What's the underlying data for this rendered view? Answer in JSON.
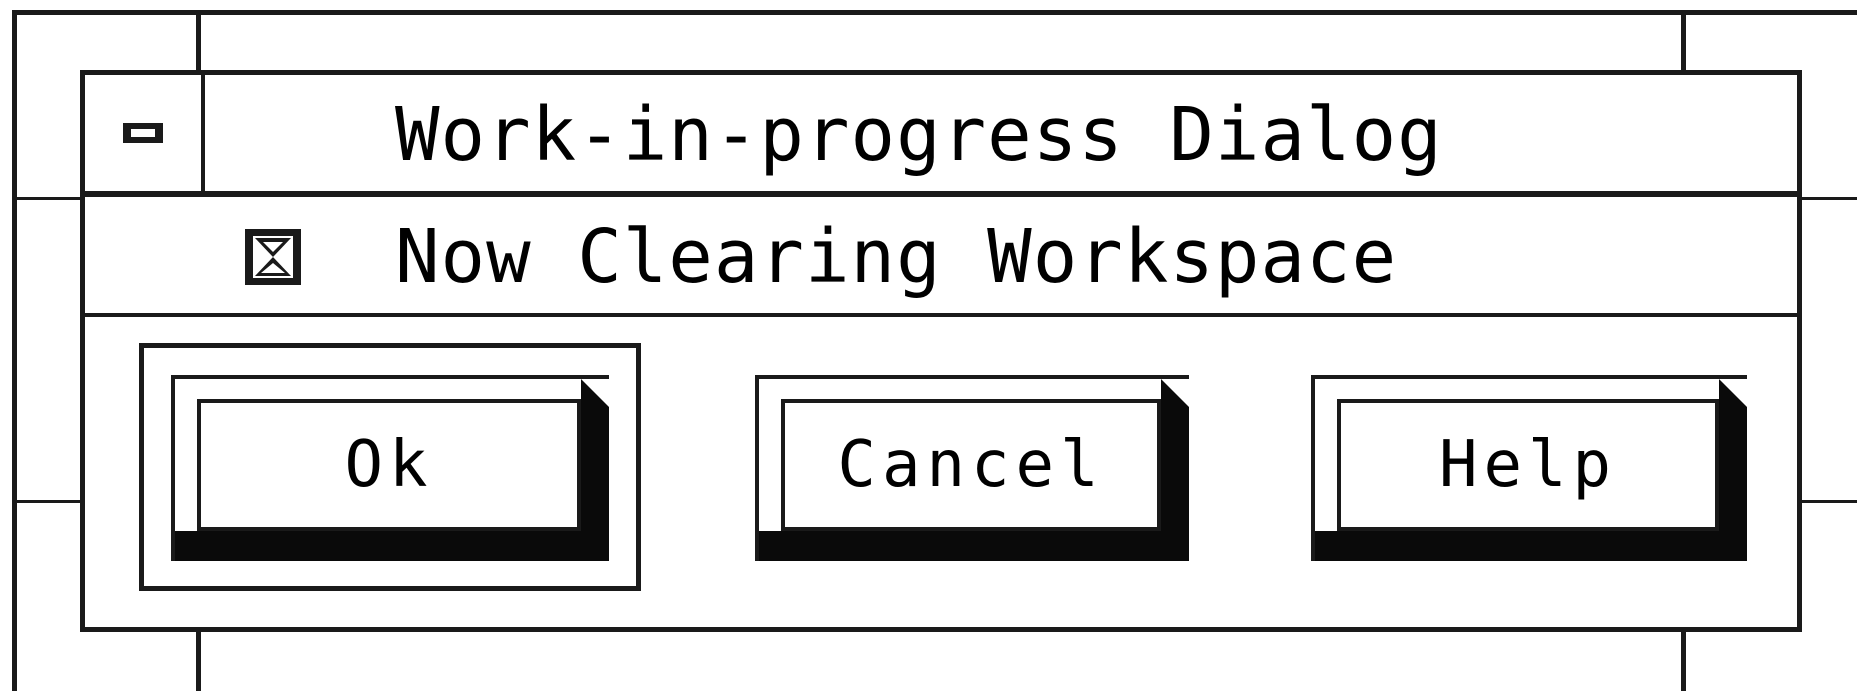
{
  "dialog": {
    "title": "Work-in-progress Dialog",
    "system_menu_icon": "system-menu-icon",
    "status_icon": "hourglass-icon",
    "status_text": "Now Clearing Workspace",
    "buttons": {
      "ok": "Ok",
      "cancel": "Cancel",
      "help": "Help"
    },
    "default_button": "ok"
  },
  "colors": {
    "foreground": "#1a1a1a",
    "background": "#ffffff"
  }
}
